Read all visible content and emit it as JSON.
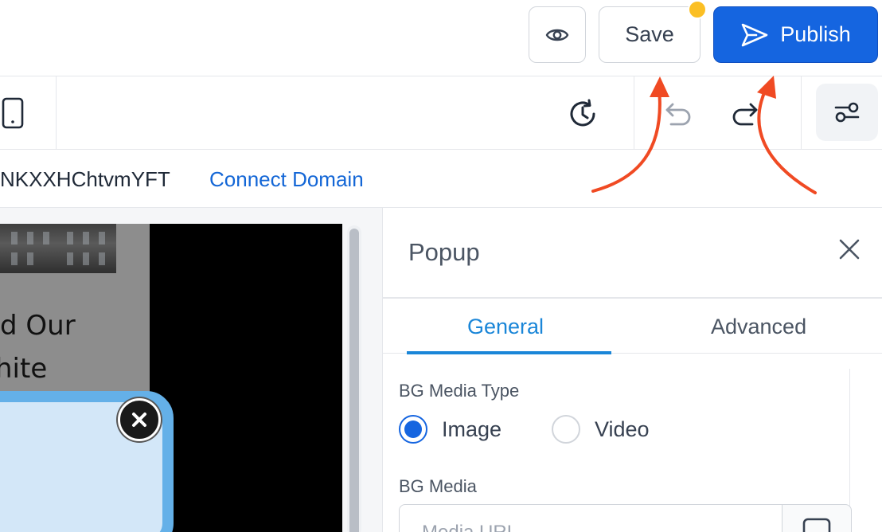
{
  "header": {
    "preview_icon": "eye-icon",
    "save_label": "Save",
    "publish_label": "Publish",
    "publish_icon": "send-icon",
    "colors": {
      "publish_bg": "#1565e0",
      "unsaved_dot": "#fbbf24"
    }
  },
  "toolbar": {
    "device_icon": "tablet-icon",
    "history_icon": "history-icon",
    "undo_icon": "undo-icon",
    "redo_icon": "redo-icon",
    "settings_icon": "sliders-icon"
  },
  "domain": {
    "site_id": "NKXXHChtvmYFT",
    "connect_label": "Connect Domain"
  },
  "canvas": {
    "preview_lines": [
      "d Our",
      "hite"
    ]
  },
  "panel": {
    "title": "Popup",
    "tabs": [
      {
        "label": "General",
        "active": true
      },
      {
        "label": "Advanced",
        "active": false
      }
    ],
    "bg_media_type": {
      "label": "BG Media Type",
      "options": [
        {
          "label": "Image",
          "checked": true
        },
        {
          "label": "Video",
          "checked": false
        }
      ]
    },
    "bg_media": {
      "label": "BG Media",
      "placeholder": "Media URL"
    },
    "colors": {
      "accent": "#1a86d8"
    }
  },
  "annotations": {
    "arrow_color": "#f04a23"
  }
}
